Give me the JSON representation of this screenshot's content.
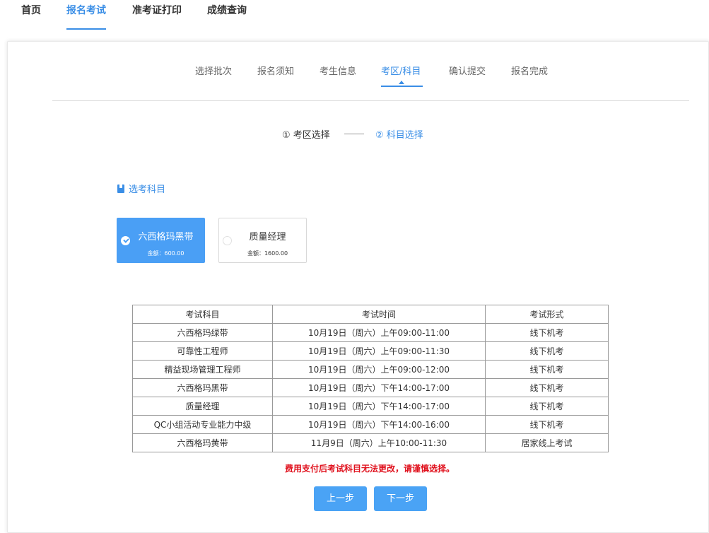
{
  "top_nav": {
    "items": [
      {
        "label": "首页",
        "active": false
      },
      {
        "label": "报名考试",
        "active": true
      },
      {
        "label": "准考证打印",
        "active": false
      },
      {
        "label": "成绩查询",
        "active": false
      }
    ],
    "accent_color": "#3a8ee6"
  },
  "steps": [
    {
      "label": "选择批次"
    },
    {
      "label": "报名须知"
    },
    {
      "label": "考生信息"
    },
    {
      "label": "考区/科目",
      "active": true
    },
    {
      "label": "确认提交"
    },
    {
      "label": "报名完成"
    }
  ],
  "sub_steps": {
    "first": "① 考区选择",
    "second": "② 科目选择"
  },
  "section_title": "选考科目",
  "subjects": [
    {
      "name": "六西格玛黑带",
      "price": "金额：600.00",
      "selected": true
    },
    {
      "name": "质量经理",
      "price": "金额：1600.00",
      "selected": false
    }
  ],
  "schedule_table": {
    "headers": [
      "考试科目",
      "考试时间",
      "考试形式"
    ],
    "rows": [
      [
        "六西格玛绿带",
        "10月19日（周六）上午09:00-11:00",
        "线下机考"
      ],
      [
        "可靠性工程师",
        "10月19日（周六）上午09:00-11:30",
        "线下机考"
      ],
      [
        "精益现场管理工程师",
        "10月19日（周六）上午09:00-12:00",
        "线下机考"
      ],
      [
        "六西格玛黑带",
        "10月19日（周六）下午14:00-17:00",
        "线下机考"
      ],
      [
        "质量经理",
        "10月19日（周六）下午14:00-17:00",
        "线下机考"
      ],
      [
        "QC小组活动专业能力中级",
        "10月19日（周六）下午14:00-16:00",
        "线下机考"
      ],
      [
        "六西格玛黄带",
        "11月9日（周六）上午10:00-11:30",
        "居家线上考试"
      ]
    ]
  },
  "warning": "费用支付后考试科目无法更改，请谨慎选择。",
  "buttons": {
    "prev": "上一步",
    "next": "下一步"
  },
  "colors": {
    "primary": "#4a9ff5",
    "warning": "#e0101c"
  }
}
